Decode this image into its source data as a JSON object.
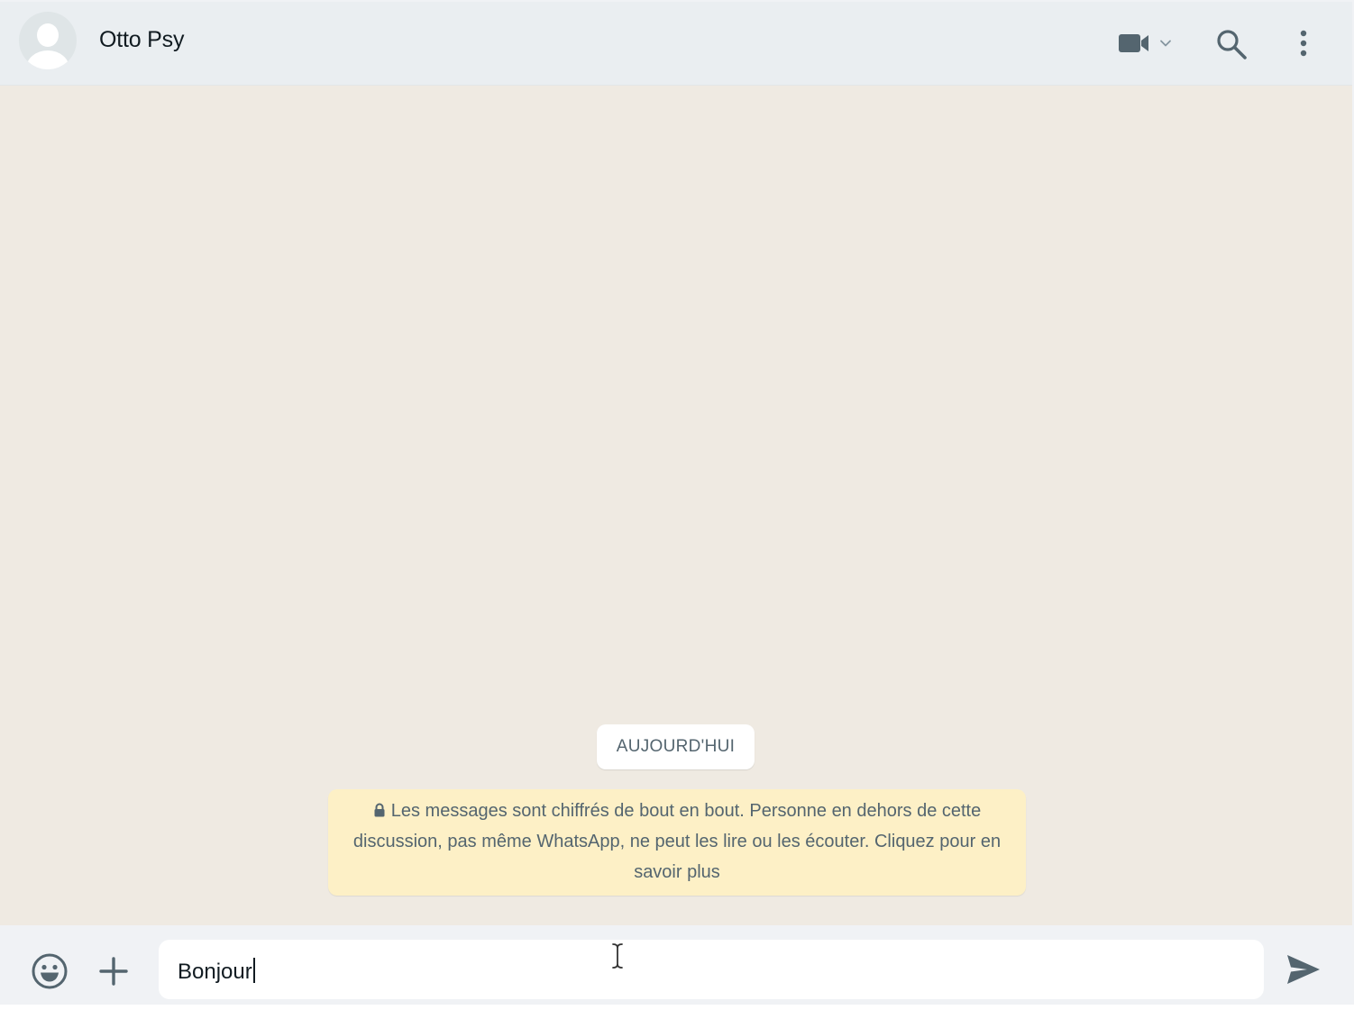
{
  "header": {
    "contact_name": "Otto Psy",
    "icons": [
      "avatar",
      "video-call-icon",
      "chevron-down-icon",
      "search-icon",
      "more-vert-icon"
    ]
  },
  "chat": {
    "date_label": "AUJOURD'HUI",
    "encryption_notice": "Les messages sont chiffrés de bout en bout. Personne en dehors de cette discussion, pas même WhatsApp, ne peut les lire ou les écouter. Cliquez pour en savoir plus"
  },
  "composer": {
    "input_value": "Bonjour",
    "icons": [
      "emoji-icon",
      "plus-icon",
      "send-icon"
    ]
  },
  "colors": {
    "header_bg": "#eaeef1",
    "chat_bg": "#efeae2",
    "notice_bg": "#fdf0c6",
    "icon": "#54656f",
    "text": "#111b21"
  }
}
